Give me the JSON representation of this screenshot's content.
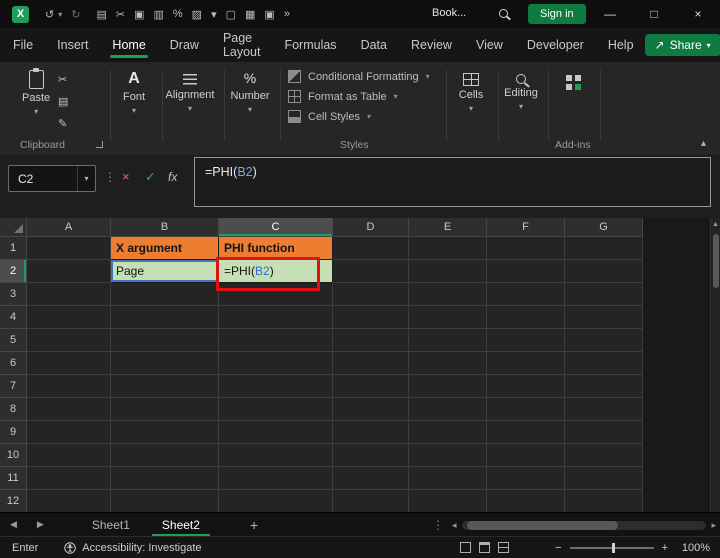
{
  "colors": {
    "excel_green": "#1e9e5a",
    "button_green": "#0f7b41",
    "orange_fill": "#ED7D31",
    "green_fill": "#C5E0B4",
    "reference_blue": "#4472C4",
    "annotation_red": "#e11212"
  },
  "icons": {
    "logo": "X",
    "undo": "↺",
    "redo": "↻",
    "dropdown": "▾",
    "collapse": "▴",
    "qat": [
      "▤",
      "✂",
      "▣",
      "▥",
      "%",
      "▨",
      "▾",
      "▢",
      "▦",
      "▣"
    ],
    "more": "»",
    "minimize": "—",
    "maximize": "□",
    "close": "×",
    "share_arrow": "↗",
    "scissors": "✂",
    "copy": "▤",
    "format_painter": "✎",
    "font_a": "A",
    "percent": "%",
    "dots_v": "⋮",
    "cancel": "×",
    "confirm": "✓",
    "nav_left": "◀",
    "nav_right": "▶",
    "scroll_left": "◂",
    "scroll_right": "▸",
    "scroll_up": "▲",
    "plus": "+",
    "zoom_out": "−",
    "zoom_in": "+"
  },
  "titlebar": {
    "title": "Book...",
    "sign_in": "Sign in"
  },
  "menu": {
    "items": [
      "File",
      "Insert",
      "Home",
      "Draw",
      "Page Layout",
      "Formulas",
      "Data",
      "Review",
      "View",
      "Developer",
      "Help"
    ],
    "active": "Home",
    "share": "Share"
  },
  "ribbon": {
    "paste": "Paste",
    "font": "Font",
    "alignment": "Alignment",
    "number": "Number",
    "styles_buttons": [
      "Conditional Formatting",
      "Format as Table",
      "Cell Styles"
    ],
    "cells": "Cells",
    "editing": "Editing",
    "group_labels": {
      "clipboard": "Clipboard",
      "styles": "Styles",
      "addins": "Add-ins"
    }
  },
  "formula_bar": {
    "name_box": "C2",
    "fx": "fx",
    "formula": {
      "prefix": "=PHI(",
      "ref": "B2",
      "suffix": ")"
    }
  },
  "grid": {
    "columns": [
      "A",
      "B",
      "C",
      "D",
      "E",
      "F",
      "G"
    ],
    "rows": [
      "1",
      "2",
      "3",
      "4",
      "5",
      "6",
      "7",
      "8",
      "9",
      "10",
      "11",
      "12"
    ],
    "cells": {
      "B1": "X argument",
      "C1": "PHI function",
      "B2": "Page",
      "C2": {
        "prefix": "=PHI(",
        "ref": "B2",
        "suffix": ")"
      }
    }
  },
  "sheet_tabs": {
    "tabs": [
      "Sheet1",
      "Sheet2"
    ],
    "active": "Sheet2"
  },
  "status_bar": {
    "mode": "Enter",
    "accessibility": "Accessibility: Investigate",
    "zoom_level": "100%"
  }
}
